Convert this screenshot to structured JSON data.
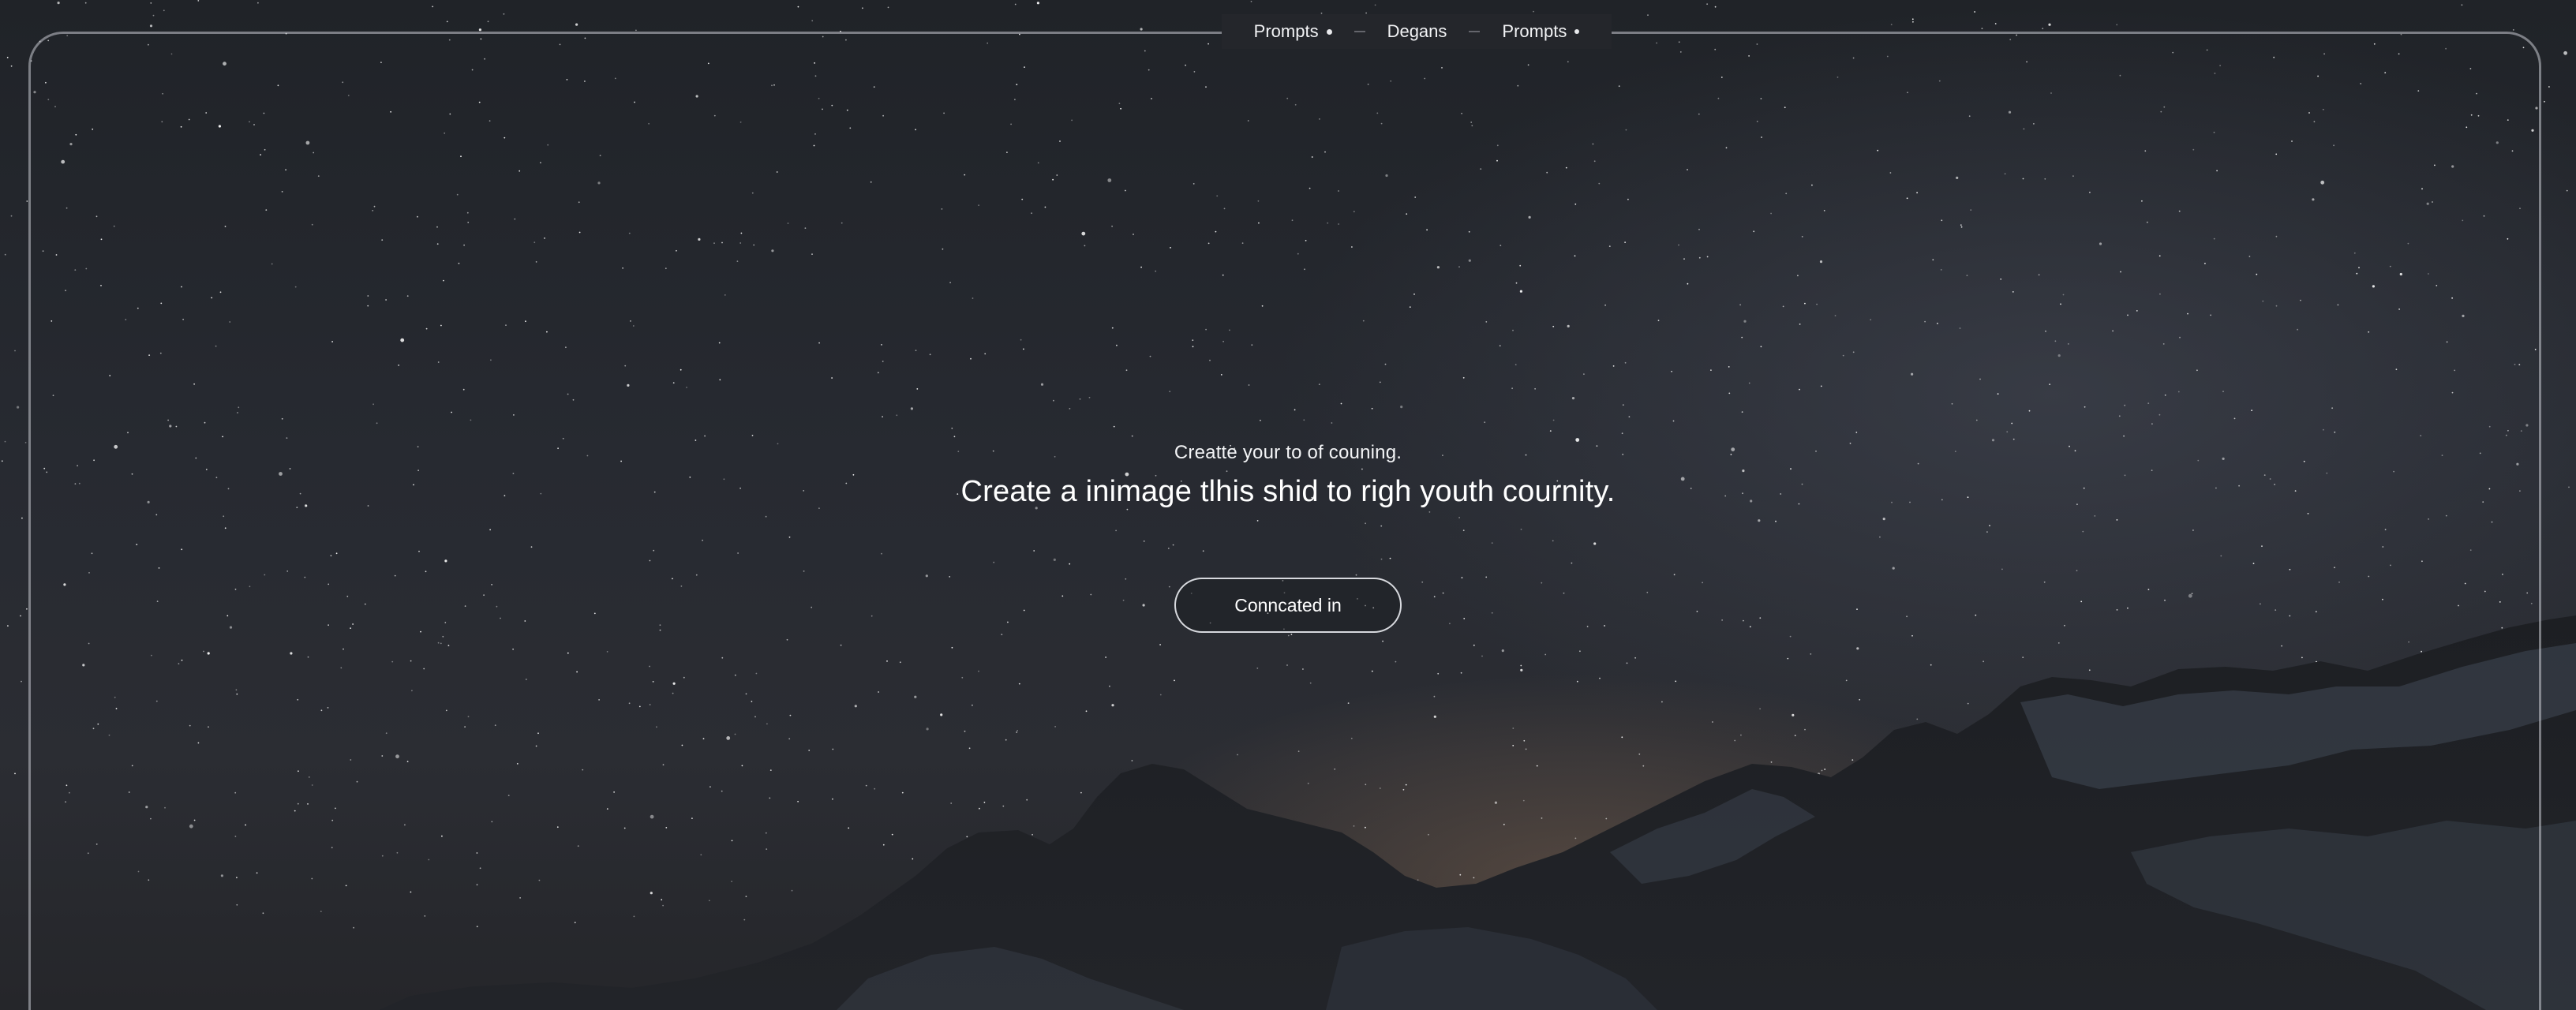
{
  "nav": {
    "items": [
      {
        "label": "Prompts",
        "icon": "dot-icon"
      },
      {
        "label": "Degans",
        "icon": ""
      },
      {
        "label": "Prompts",
        "icon": "dot-icon"
      }
    ]
  },
  "hero": {
    "subtitle": "Creatte your to of couning.",
    "headline": "Create a inimage tlhis shid to righ youth cournity.",
    "cta_label": "Conncated in"
  },
  "colors": {
    "background": "#26282e",
    "frame": "#c8cbd2",
    "text": "#ffffff"
  }
}
